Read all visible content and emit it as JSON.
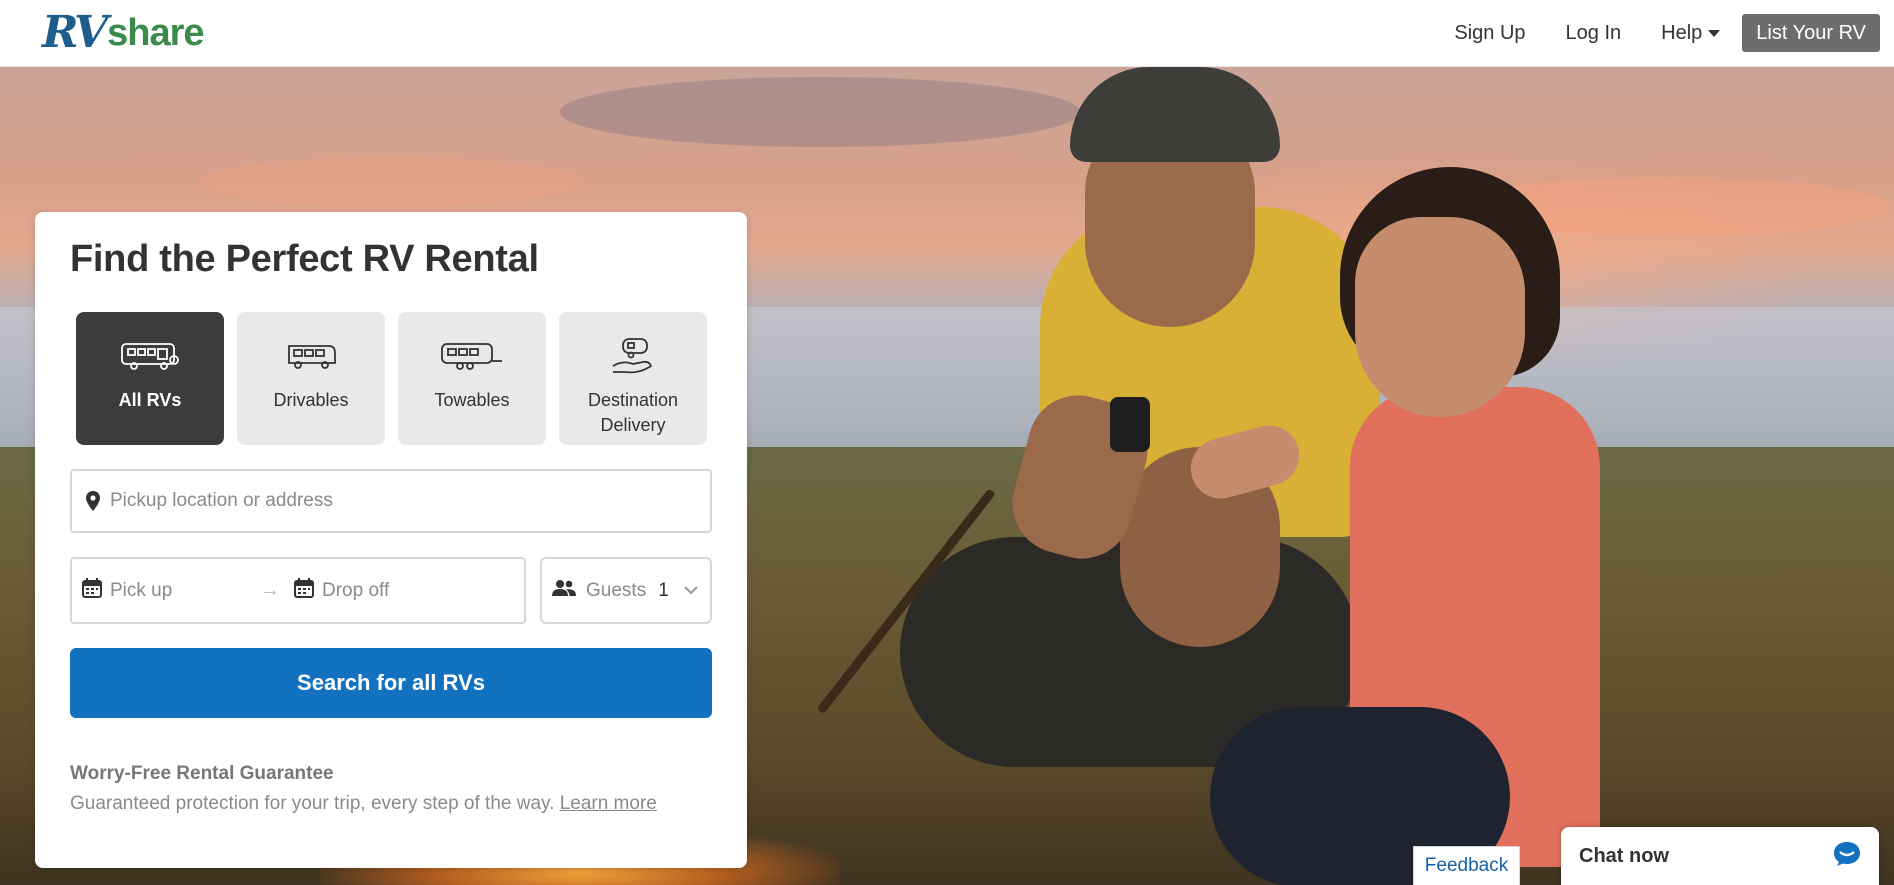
{
  "header": {
    "logo": {
      "rv": "RV",
      "share": "share"
    },
    "nav": {
      "sign_up": "Sign Up",
      "log_in": "Log In",
      "help": "Help",
      "list_rv": "List Your RV"
    }
  },
  "search_card": {
    "title": "Find the Perfect RV Rental",
    "types": [
      {
        "label": "All RVs",
        "icon": "all-rvs-icon",
        "selected": true
      },
      {
        "label": "Drivables",
        "icon": "motorhome-icon",
        "selected": false
      },
      {
        "label": "Towables",
        "icon": "trailer-icon",
        "selected": false
      },
      {
        "label": "Destination Delivery",
        "icon": "delivery-icon",
        "selected": false
      }
    ],
    "location_placeholder": "Pickup location or address",
    "pickup_placeholder": "Pick up",
    "dropoff_placeholder": "Drop off",
    "date_arrow": "→",
    "guests_label": "Guests",
    "guests_value": "1",
    "search_button": "Search for all RVs",
    "guarantee_title": "Worry-Free Rental Guarantee",
    "guarantee_text": "Guaranteed protection for your trip, every step of the way.",
    "learn_more": "Learn more"
  },
  "feedback": "Feedback",
  "chat": {
    "label": "Chat now"
  },
  "colors": {
    "primary": "#1372bf",
    "active_type": "#3c3c3c",
    "logo_blue": "#1f5d8c",
    "logo_green": "#3a8a4b",
    "list_rv_bg": "#6d6d6d"
  }
}
